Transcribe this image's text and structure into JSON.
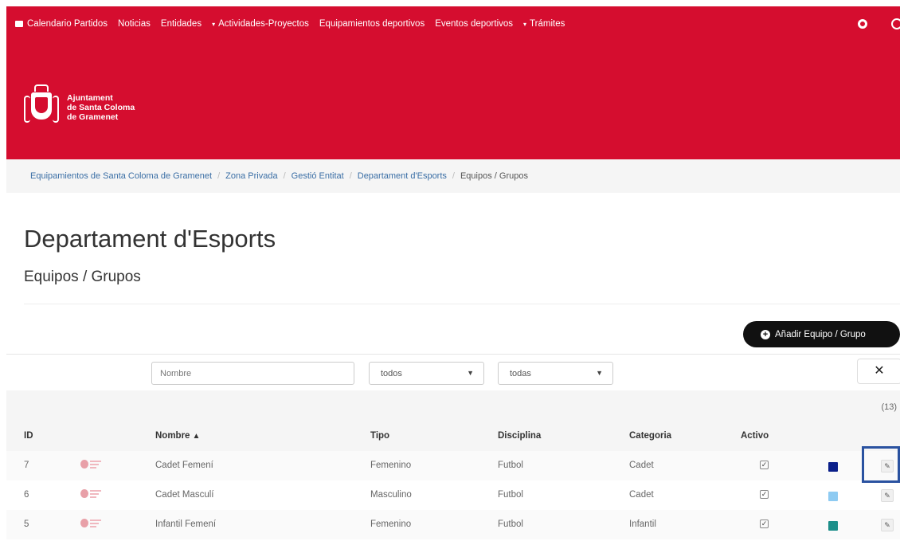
{
  "nav": {
    "items": [
      {
        "label": "Calendario Partidos",
        "icon": "calendar-icon",
        "dropdown": false
      },
      {
        "label": "Noticias",
        "dropdown": false
      },
      {
        "label": "Entidades",
        "dropdown": false
      },
      {
        "label": "Actividades-Proyectos",
        "dropdown": true
      },
      {
        "label": "Equipamientos deportivos",
        "dropdown": false
      },
      {
        "label": "Eventos deportivos",
        "dropdown": false
      },
      {
        "label": "Trámites",
        "dropdown": true
      }
    ],
    "right_icons": [
      "gear-icon",
      "globe-icon"
    ]
  },
  "logo": {
    "line1": "Ajuntament",
    "line2": "de Santa Coloma",
    "line3": "de Gramenet"
  },
  "breadcrumb": {
    "items": [
      "Equipamientos de Santa Coloma de Gramenet",
      "Zona Privada",
      "Gestió Entitat",
      "Departament d'Esports"
    ],
    "separator": "/",
    "current": "Equipos / Grupos"
  },
  "page": {
    "title": "Departament d'Esports",
    "subtitle": "Equipos / Grupos",
    "add_button": "Añadir Equipo / Grupo"
  },
  "filters": {
    "name_placeholder": "Nombre",
    "tipo_value": "todos",
    "disciplina_value": "todas",
    "clear_label": "✕"
  },
  "count": "(13)",
  "table": {
    "headers": {
      "id": "ID",
      "nombre": "Nombre",
      "tipo": "Tipo",
      "disciplina": "Disciplina",
      "categoria": "Categoria",
      "activo": "Activo"
    },
    "rows": [
      {
        "id": "7",
        "nombre": "Cadet Femení",
        "tipo": "Femenino",
        "disciplina": "Futbol",
        "categoria": "Cadet",
        "activo": true,
        "color": "#0b1f8a"
      },
      {
        "id": "6",
        "nombre": "Cadet Masculí",
        "tipo": "Masculino",
        "disciplina": "Futbol",
        "categoria": "Cadet",
        "activo": true,
        "color": "#8ecbf2"
      },
      {
        "id": "5",
        "nombre": "Infantil Femení",
        "tipo": "Femenino",
        "disciplina": "Futbol",
        "categoria": "Infantil",
        "activo": true,
        "color": "#1d8f8a"
      }
    ]
  },
  "colors": {
    "brand_red": "#d50d2f",
    "highlight_blue": "#2a52a0",
    "link_blue": "#3a6ea5"
  }
}
